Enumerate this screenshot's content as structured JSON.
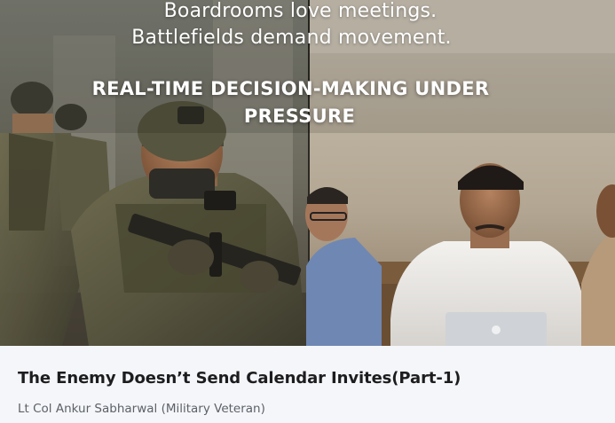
{
  "cover": {
    "tagline_line1": "Boardrooms love meetings.",
    "tagline_line2": "Battlefields demand movement.",
    "headline_line1": "REAL-TIME DECISION-MAKING UNDER",
    "headline_line2": "PRESSURE"
  },
  "article": {
    "title": "The Enemy Doesn’t Send Calendar Invites(Part-1)",
    "author": "Lt Col Ankur Sabharwal (Military Veteran)"
  },
  "colors": {
    "page_background": "#f4f6f9",
    "title_text": "#1d1d1f",
    "author_text": "#5d6168"
  }
}
